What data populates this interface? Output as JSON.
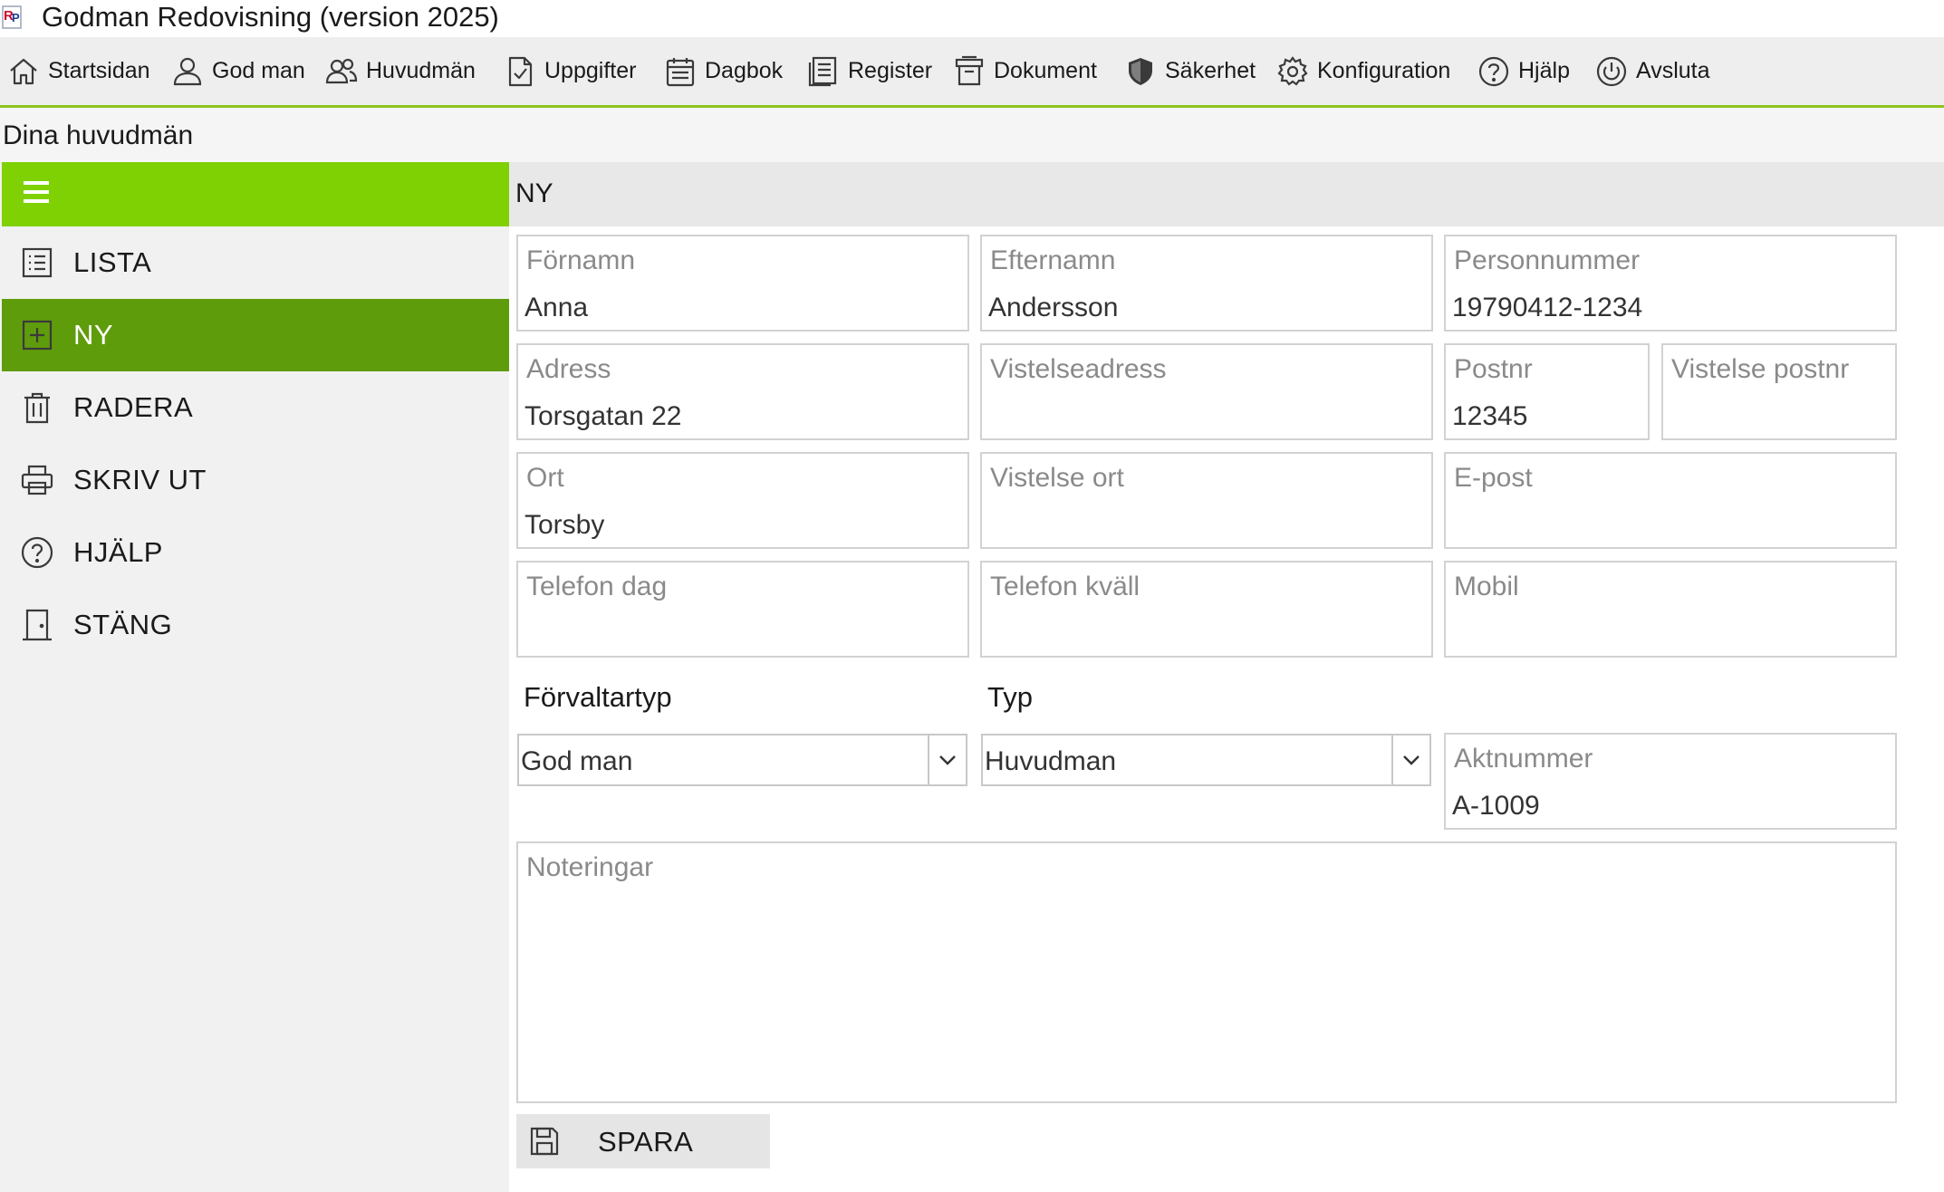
{
  "app": {
    "title": "Godman Redovisning (version 2025)"
  },
  "menu": [
    {
      "label": "Startsidan",
      "icon": "home-icon"
    },
    {
      "label": "God man",
      "icon": "person-icon"
    },
    {
      "label": "Huvudmän",
      "icon": "people-icon"
    },
    {
      "label": "Uppgifter",
      "icon": "task-icon"
    },
    {
      "label": "Dagbok",
      "icon": "calendar-icon"
    },
    {
      "label": "Register",
      "icon": "register-icon"
    },
    {
      "label": "Dokument",
      "icon": "archive-icon"
    },
    {
      "label": "Säkerhet",
      "icon": "shield-icon"
    },
    {
      "label": "Konfiguration",
      "icon": "gear-icon"
    },
    {
      "label": "Hjälp",
      "icon": "help-icon"
    },
    {
      "label": "Avsluta",
      "icon": "power-icon"
    }
  ],
  "breadcrumb": "Dina huvudmän",
  "sidebar": {
    "items": [
      {
        "label": "LISTA",
        "icon": "list-icon",
        "active": false
      },
      {
        "label": "NY",
        "icon": "add-icon",
        "active": true
      },
      {
        "label": "RADERA",
        "icon": "trash-icon",
        "active": false
      },
      {
        "label": "SKRIV UT",
        "icon": "printer-icon",
        "active": false
      },
      {
        "label": "HJÄLP",
        "icon": "help-icon",
        "active": false
      },
      {
        "label": "STÄNG",
        "icon": "door-icon",
        "active": false
      }
    ]
  },
  "main": {
    "header": "NY",
    "fields": {
      "fornamn": {
        "label": "Förnamn",
        "value": "Anna"
      },
      "efternamn": {
        "label": "Efternamn",
        "value": "Andersson"
      },
      "personnummer": {
        "label": "Personnummer",
        "value": "19790412-1234"
      },
      "adress": {
        "label": "Adress",
        "value": "Torsgatan 22"
      },
      "vistelseadress": {
        "label": "Vistelseadress",
        "value": ""
      },
      "postnr": {
        "label": "Postnr",
        "value": "12345"
      },
      "vistelse_postnr": {
        "label": "Vistelse postnr",
        "value": ""
      },
      "ort": {
        "label": "Ort",
        "value": "Torsby"
      },
      "vistelse_ort": {
        "label": "Vistelse ort",
        "value": ""
      },
      "epost": {
        "label": "E-post",
        "value": ""
      },
      "telefon_dag": {
        "label": "Telefon dag",
        "value": ""
      },
      "telefon_kvall": {
        "label": "Telefon kväll",
        "value": ""
      },
      "mobil": {
        "label": "Mobil",
        "value": ""
      },
      "aktnummer": {
        "label": "Aktnummer",
        "value": "A-1009"
      }
    },
    "forvaltartyp": {
      "label": "Förvaltartyp",
      "selected": "God man"
    },
    "typ": {
      "label": "Typ",
      "selected": "Huvudman"
    },
    "noteringar": {
      "label": "Noteringar",
      "value": ""
    },
    "save_label": "SPARA"
  },
  "colors": {
    "accent_green": "#7fd104",
    "active_green": "#5f9c0c",
    "menu_underline": "#8ec31f"
  }
}
